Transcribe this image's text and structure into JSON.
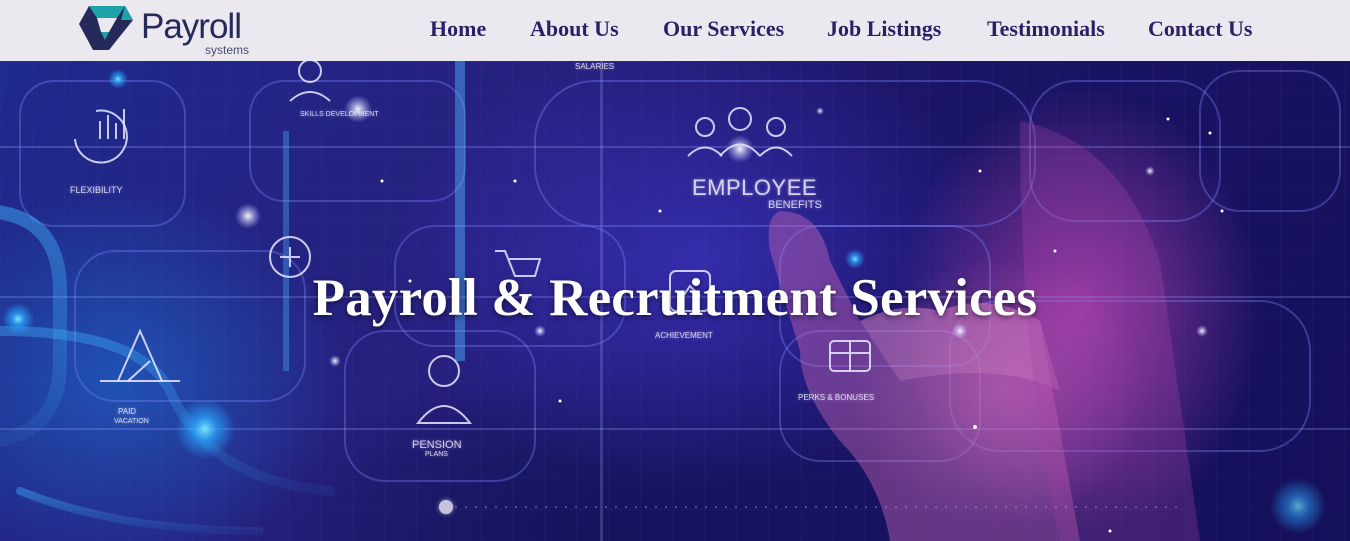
{
  "header": {
    "logo": {
      "wordmark": "Payroll",
      "subtitle": "systems",
      "mark_color_primary": "#1fa3a8",
      "mark_color_secondary": "#252a5a"
    },
    "nav": [
      {
        "label": "Home"
      },
      {
        "label": "About Us"
      },
      {
        "label": "Our Services"
      },
      {
        "label": "Job Listings"
      },
      {
        "label": "Testimonials"
      },
      {
        "label": "Contact Us"
      }
    ],
    "nav_color": "#2d1f66",
    "background": "#ebe9ef"
  },
  "hero": {
    "title": "Payroll & Recruitment Services",
    "image_labels": {
      "employee": "Employee",
      "benefits": "Benefits",
      "flexibility": "Flexibility",
      "pension": "Pension",
      "pension_sub": "Plans",
      "paid": "Paid",
      "paid_sub": "Vacation",
      "perks": "Perks & Bonuses",
      "achievement": "Achievement",
      "salaries": "Salaries",
      "skills": "Skills Development"
    },
    "slider": {
      "active_index": 0
    }
  }
}
